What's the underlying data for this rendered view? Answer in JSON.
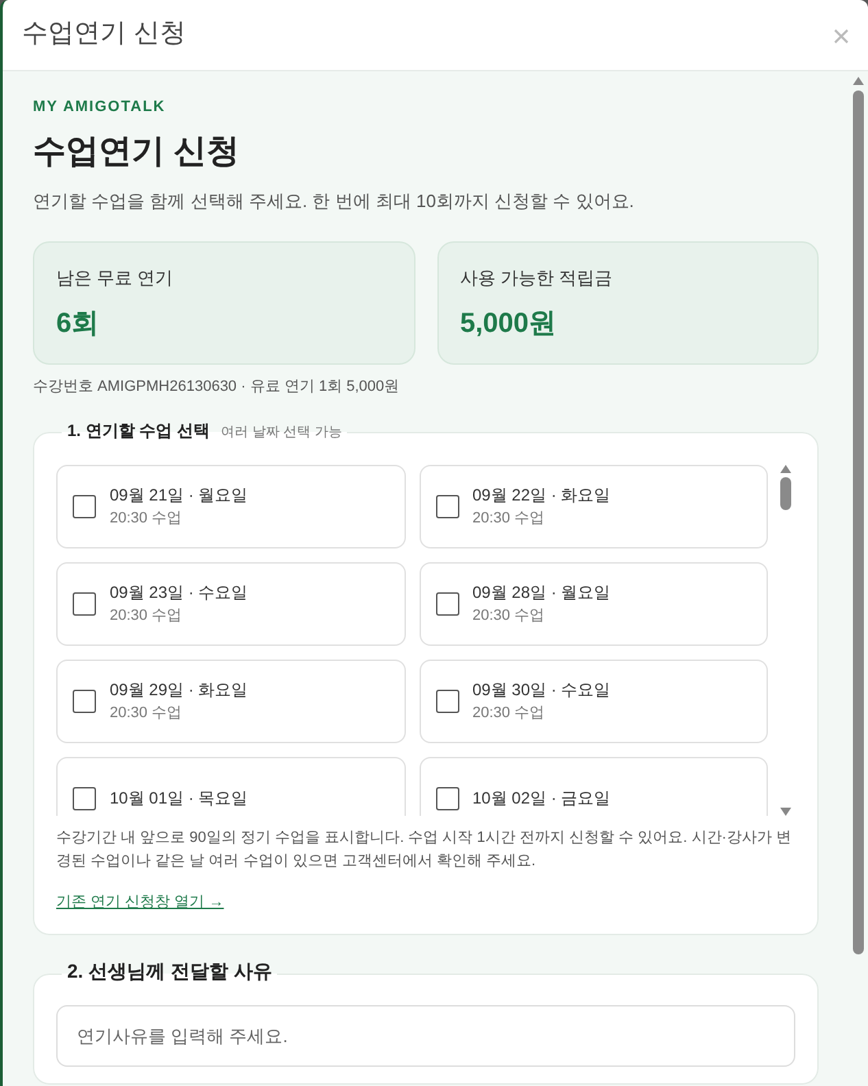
{
  "window": {
    "title": "수업연기 신청"
  },
  "eyebrow": "MY AMIGOTALK",
  "heading": "수업연기 신청",
  "intro": "연기할 수업을 함께 선택해 주세요. 한 번에 최대 10회까지 신청할 수 있어요.",
  "stats": [
    {
      "label": "남은 무료 연기",
      "value": "6회"
    },
    {
      "label": "사용 가능한 적립금",
      "value": "5,000원"
    }
  ],
  "enrollment_note": "수강번호 AMIGPMH26130630 · 유료 연기 1회 5,000원",
  "section_1": {
    "title": "1. 연기할 수업 선택",
    "hint": "여러 날짜 선택 가능",
    "classes": [
      {
        "date": "09월 21일 · 월요일",
        "time": "20:30 수업",
        "checked": false
      },
      {
        "date": "09월 22일 · 화요일",
        "time": "20:30 수업",
        "checked": false
      },
      {
        "date": "09월 23일 · 수요일",
        "time": "20:30 수업",
        "checked": false
      },
      {
        "date": "09월 28일 · 월요일",
        "time": "20:30 수업",
        "checked": false
      },
      {
        "date": "09월 29일 · 화요일",
        "time": "20:30 수업",
        "checked": false
      },
      {
        "date": "09월 30일 · 수요일",
        "time": "20:30 수업",
        "checked": false
      },
      {
        "date": "10월 01일 · 목요일",
        "checked": false
      },
      {
        "date": "10월 02일 · 금요일",
        "checked": false
      }
    ],
    "notice": "수강기간 내 앞으로 90일의 정기 수업을 표시합니다. 수업 시작 1시간 전까지 신청할 수 있어요. 시간·강사가 변경된 수업이나 같은 날 여러 수업이 있으면 고객센터에서 확인해 주세요.",
    "link": "기존 연기 신청창 열기 →"
  },
  "section_2": {
    "title": "2. 선생님께 전달할 사유",
    "placeholder": "연기사유를 입력해 주세요."
  }
}
